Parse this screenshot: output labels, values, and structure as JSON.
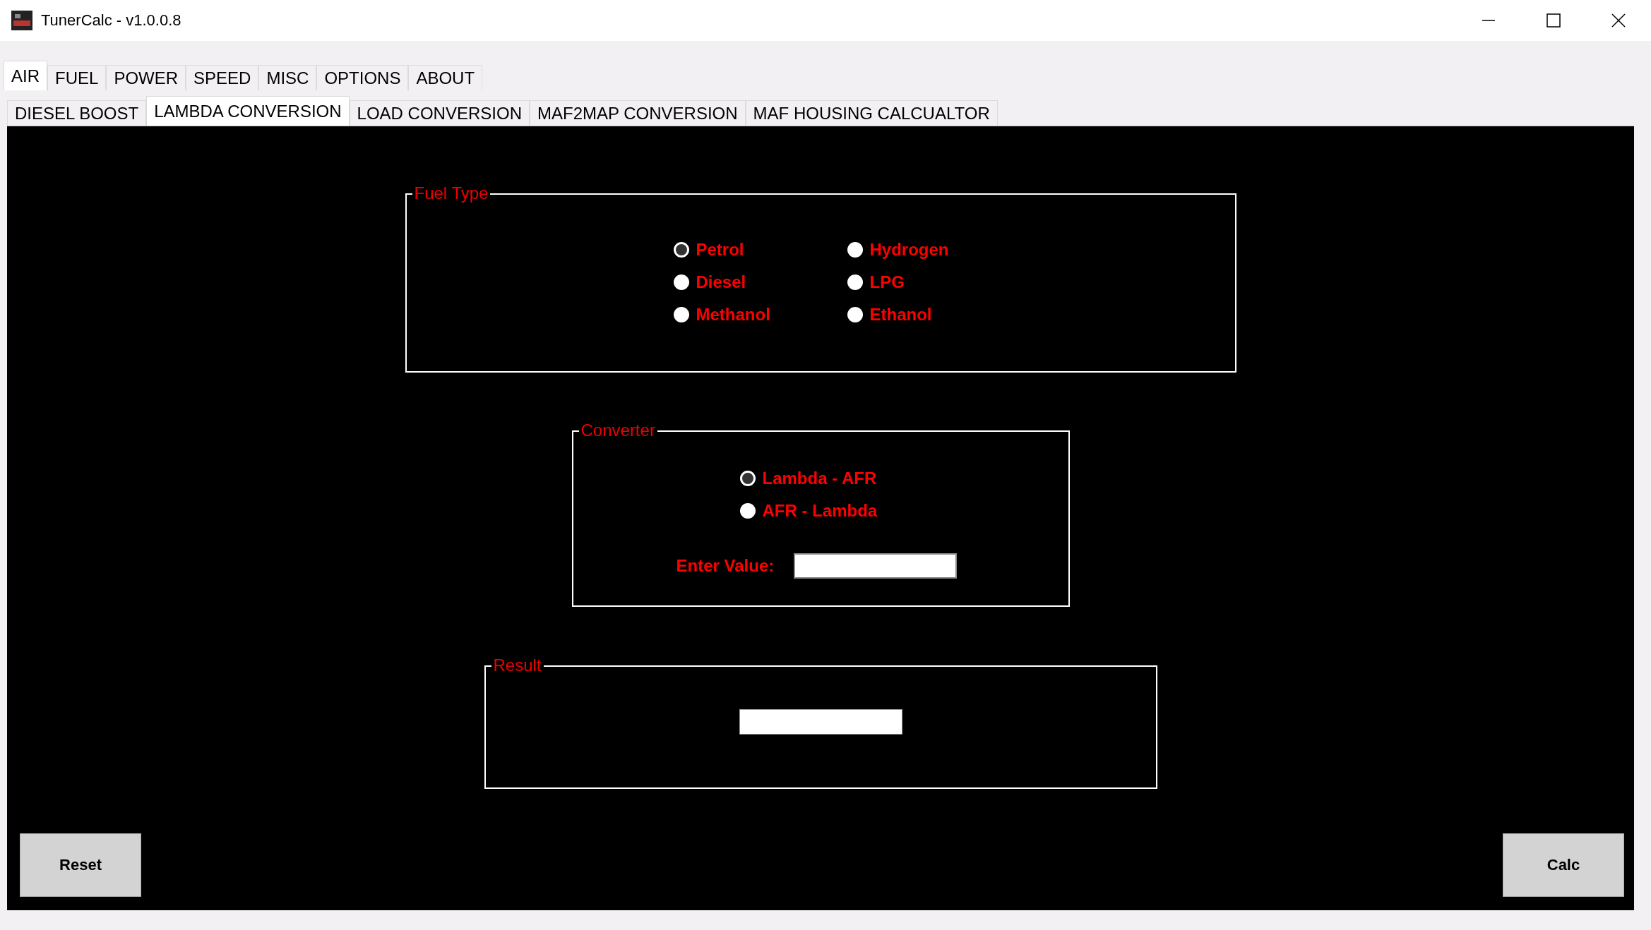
{
  "window": {
    "title": "TunerCalc - v1.0.0.8"
  },
  "tabs": [
    {
      "label": "AIR",
      "selected": true
    },
    {
      "label": "FUEL",
      "selected": false
    },
    {
      "label": "POWER",
      "selected": false
    },
    {
      "label": "SPEED",
      "selected": false
    },
    {
      "label": "MISC",
      "selected": false
    },
    {
      "label": "OPTIONS",
      "selected": false
    },
    {
      "label": "ABOUT",
      "selected": false
    }
  ],
  "subtabs": [
    {
      "label": "DIESEL BOOST",
      "selected": false
    },
    {
      "label": "LAMBDA CONVERSION",
      "selected": true
    },
    {
      "label": "LOAD CONVERSION",
      "selected": false
    },
    {
      "label": "MAF2MAP CONVERSION",
      "selected": false
    },
    {
      "label": "MAF HOUSING CALCUALTOR",
      "selected": false
    }
  ],
  "fuel_type": {
    "title": "Fuel Type",
    "options": [
      {
        "label": "Petrol",
        "selected": true
      },
      {
        "label": "Hydrogen",
        "selected": false
      },
      {
        "label": "Diesel",
        "selected": false
      },
      {
        "label": "LPG",
        "selected": false
      },
      {
        "label": "Methanol",
        "selected": false
      },
      {
        "label": "Ethanol",
        "selected": false
      }
    ]
  },
  "converter": {
    "title": "Converter",
    "options": [
      {
        "label": "Lambda - AFR",
        "selected": true
      },
      {
        "label": "AFR - Lambda",
        "selected": false
      }
    ],
    "value_label": "Enter Value:"
  },
  "result": {
    "title": "Result"
  },
  "buttons": [
    "Reset",
    "Calc"
  ]
}
